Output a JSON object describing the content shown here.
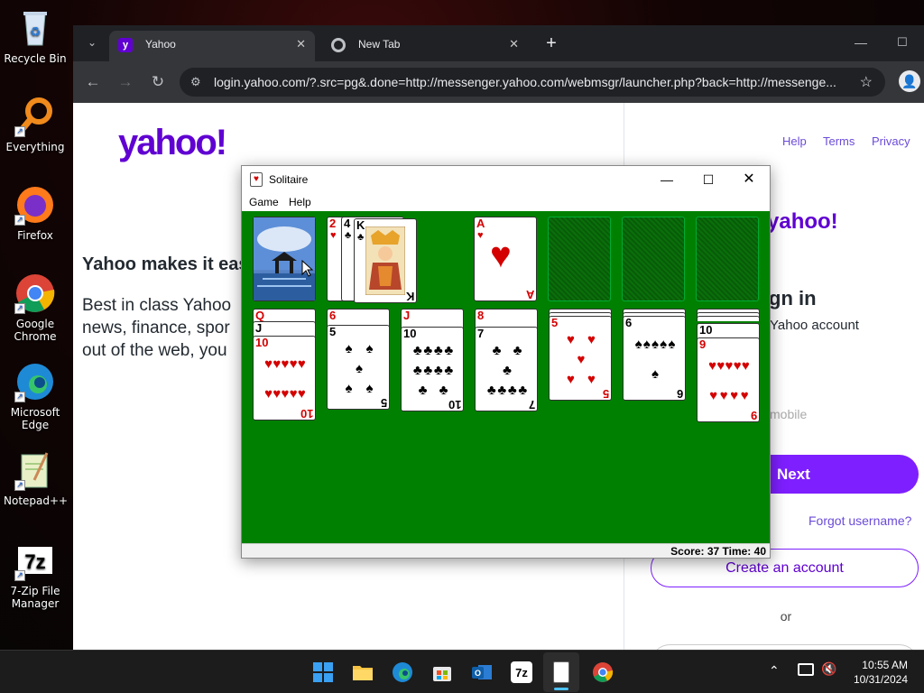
{
  "desktop": {
    "icons": [
      {
        "label": "Recycle Bin"
      },
      {
        "label": "Everything"
      },
      {
        "label": "Firefox"
      },
      {
        "label": "Google Chrome"
      },
      {
        "label": "Microsoft Edge"
      },
      {
        "label": "Notepad++"
      },
      {
        "label": "7-Zip File Manager"
      }
    ]
  },
  "browser": {
    "tabs": [
      {
        "title": "Yahoo",
        "active": true
      },
      {
        "title": "New Tab",
        "active": false
      }
    ],
    "url": "login.yahoo.com/?.src=pg&.done=http://messenger.yahoo.com/webmsgr/launcher.php?back=http://messenge...",
    "new_tab_symbol": "+"
  },
  "page": {
    "logo": "yahoo!",
    "header_links": [
      "Help",
      "Terms",
      "Privacy"
    ],
    "tagline": "Yahoo makes it eas",
    "description": "Best in class Yahoo\nnews, finance, spor\nout of the web, you",
    "card": {
      "logo": "yahoo!",
      "signin_title": "gn in",
      "signin_subtitle": "Yahoo account",
      "mobile_placeholder": "mobile",
      "next_label": "Next",
      "forgot_label": "Forgot username?",
      "create_label": "Create an account",
      "or_label": "or"
    }
  },
  "solitaire": {
    "title": "Solitaire",
    "menu": [
      "Game",
      "Help"
    ],
    "status": "Score: 37 Time: 40",
    "waste": [
      {
        "rank": "2",
        "suit": "♥"
      },
      {
        "rank": "4",
        "suit": "♣"
      },
      {
        "rank": "K",
        "suit": "♣"
      }
    ],
    "foundation": [
      {
        "rank": "A",
        "suit": "♥"
      }
    ],
    "tableau": [
      {
        "hidden": [
          "Q",
          "J"
        ],
        "top": {
          "rank": "10",
          "suit": "♥"
        }
      },
      {
        "hidden": [
          "6"
        ],
        "top": {
          "rank": "5",
          "suit": "♠"
        }
      },
      {
        "hidden": [
          "J"
        ],
        "top": {
          "rank": "10",
          "suit": "♣"
        }
      },
      {
        "hidden": [
          "8"
        ],
        "top": {
          "rank": "7",
          "suit": "♣"
        }
      },
      {
        "hidden": [],
        "top": {
          "rank": "5",
          "suit": "♥"
        }
      },
      {
        "hidden": [],
        "top": {
          "rank": "6",
          "suit": "♠"
        }
      },
      {
        "hidden": [
          "10"
        ],
        "top": {
          "rank": "9",
          "suit": "♥"
        }
      }
    ]
  },
  "taskbar": {
    "time": "10:55 AM",
    "date": "10/31/2024"
  },
  "colors": {
    "yahoo_purple": "#6001d2",
    "next_button": "#7e1fff",
    "felt_green": "#008000"
  }
}
